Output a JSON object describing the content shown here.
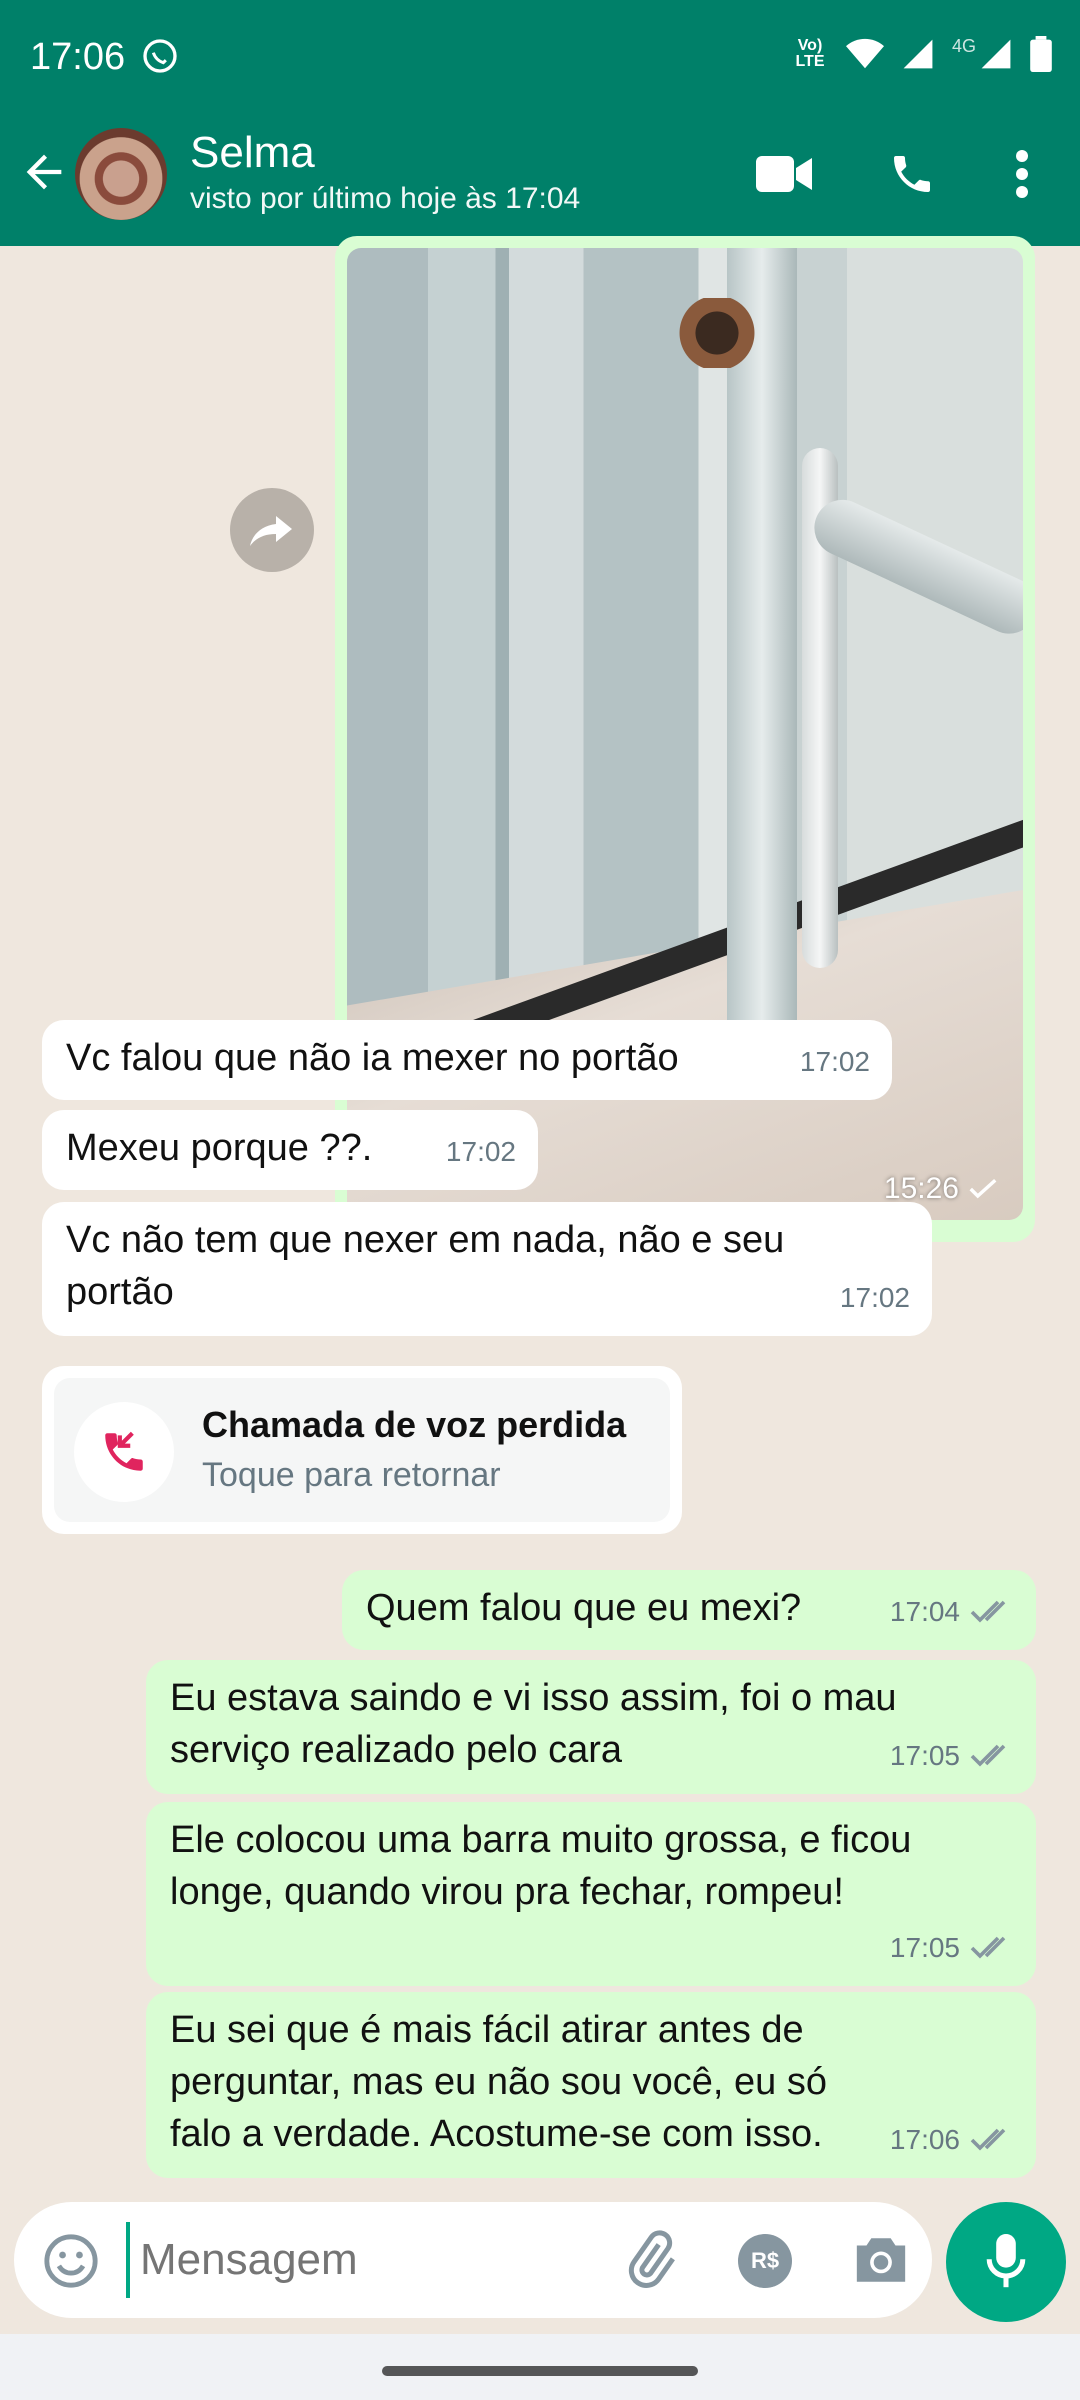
{
  "status_bar": {
    "time": "17:06",
    "volte": "Vo) LTE",
    "network": "4G"
  },
  "header": {
    "contact_name": "Selma",
    "contact_status": "visto por último hoje às 17:04"
  },
  "image_message": {
    "time": "15:26"
  },
  "messages": [
    {
      "direction": "in",
      "text": "Vc falou que não ia mexer no portão",
      "time": "17:02"
    },
    {
      "direction": "in",
      "text": "Mexeu porque ??.",
      "time": "17:02"
    },
    {
      "direction": "in",
      "text": "Vc não tem que nexer em nada, não e seu portão",
      "time": "17:02"
    },
    {
      "direction": "out",
      "text": "Quem falou que eu mexi?",
      "time": "17:04"
    },
    {
      "direction": "out",
      "text": "Eu estava saindo e vi isso assim, foi o mau serviço realizado pelo cara",
      "time": "17:05"
    },
    {
      "direction": "out",
      "text": "Ele colocou uma barra muito grossa, e ficou longe, quando virou pra fechar, rompeu!",
      "time": "17:05"
    },
    {
      "direction": "out",
      "text": "Eu sei que é mais fácil atirar antes de perguntar, mas eu não sou você, eu só falo a verdade. Acostume-se com isso.",
      "time": "17:06"
    }
  ],
  "missed_call": {
    "title": "Chamada de voz perdida",
    "subtitle": "Toque para retornar"
  },
  "composer": {
    "placeholder": "Mensagem",
    "payment_label": "R$"
  },
  "colors": {
    "header": "#008069",
    "outgoing": "#d9fdd3",
    "incoming": "#ffffff",
    "accent": "#00a884",
    "missed_call_red": "#e0245e"
  },
  "icons": [
    "back-arrow-icon",
    "video-call-icon",
    "phone-icon",
    "more-vert-icon",
    "forward-icon",
    "missed-call-icon",
    "emoji-icon",
    "attach-icon",
    "camera-icon",
    "mic-icon"
  ]
}
